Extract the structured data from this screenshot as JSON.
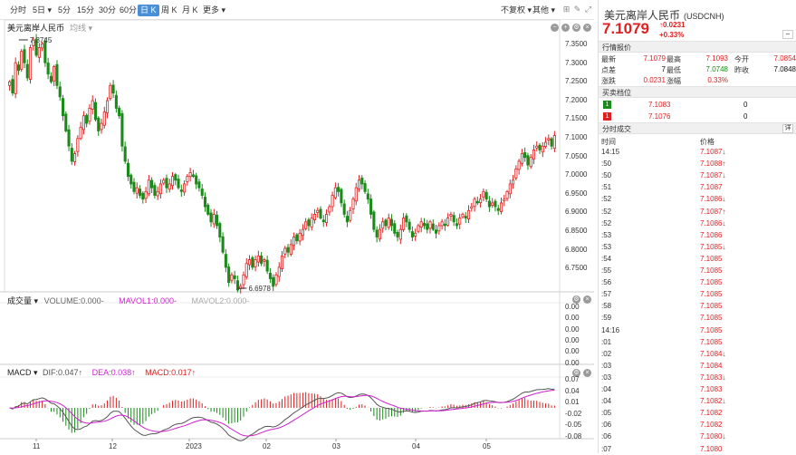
{
  "toolbar": {
    "periods": [
      "分时",
      "5日",
      "5分",
      "15分",
      "30分",
      "60分",
      "日 K",
      "周 K",
      "月 K",
      "更多"
    ],
    "active": "日 K",
    "fq": "不复权",
    "other": "其他"
  },
  "price_panel": {
    "title": "美元离岸人民币",
    "sub": "均线",
    "y_ticks": [
      "7.3500",
      "7.3000",
      "7.2500",
      "7.2000",
      "7.1500",
      "7.1000",
      "7.0500",
      "7.0000",
      "6.9500",
      "6.9000",
      "6.8500",
      "6.8000",
      "6.7500"
    ],
    "high_label": "7.3745",
    "low_label": "6.6978"
  },
  "volume_panel": {
    "title": "成交量",
    "legend": {
      "vol": "VOLUME:0.000-",
      "mavol1": "MAVOL1:0.000-",
      "mavol2": "MAVOL2:0.000-"
    },
    "y_ticks": [
      "0.00",
      "0.00",
      "0.00",
      "0.00",
      "0.00",
      "0.00"
    ]
  },
  "macd_panel": {
    "title": "MACD",
    "legend": {
      "dif": "DIF:0.047↑",
      "dea": "DEA:0.038↑",
      "macd": "MACD:0.017↑"
    },
    "y_ticks": [
      "0.07",
      "0.04",
      "0.01",
      "-0.02",
      "-0.05",
      "-0.08"
    ]
  },
  "x_labels": [
    "11",
    "12",
    "2023",
    "02",
    "03",
    "04",
    "05"
  ],
  "colors": {
    "up": "#e02020",
    "down": "#1a8a1a",
    "dif": "#555555",
    "dea": "#d020d0",
    "accent": "#4a90d9"
  },
  "chart_data": {
    "type": "candlestick",
    "y_range": [
      6.7,
      7.37
    ],
    "annotations": {
      "max": 7.3745,
      "min": 6.6978
    },
    "closes": [
      7.25,
      7.22,
      7.3,
      7.28,
      7.33,
      7.3,
      7.26,
      7.34,
      7.36,
      7.32,
      7.34,
      7.35,
      7.3,
      7.27,
      7.25,
      7.29,
      7.24,
      7.21,
      7.16,
      7.12,
      7.08,
      7.04,
      7.06,
      7.1,
      7.13,
      7.16,
      7.14,
      7.18,
      7.2,
      7.15,
      7.12,
      7.14,
      7.17,
      7.2,
      7.24,
      7.22,
      7.18,
      7.16,
      7.08,
      7.04,
      7.0,
      6.98,
      6.96,
      6.97,
      6.95,
      6.94,
      6.96,
      6.99,
      6.97,
      6.95,
      6.96,
      6.98,
      6.99,
      6.97,
      6.98,
      7.0,
      6.99,
      6.97,
      6.96,
      6.98,
      7.0,
      7.01,
      7.0,
      6.98,
      6.97,
      6.95,
      6.92,
      6.9,
      6.88,
      6.9,
      6.87,
      6.84,
      6.8,
      6.76,
      6.72,
      6.74,
      6.73,
      6.7,
      6.71,
      6.74,
      6.77,
      6.78,
      6.76,
      6.78,
      6.79,
      6.77,
      6.78,
      6.75,
      6.73,
      6.71,
      6.74,
      6.76,
      6.79,
      6.81,
      6.8,
      6.82,
      6.84,
      6.83,
      6.85,
      6.86,
      6.88,
      6.87,
      6.89,
      6.9,
      6.91,
      6.89,
      6.88,
      6.9,
      6.92,
      6.95,
      6.97,
      6.96,
      6.93,
      6.9,
      6.88,
      6.91,
      6.94,
      6.97,
      6.99,
      6.98,
      6.96,
      6.94,
      6.9,
      6.86,
      6.84,
      6.86,
      6.88,
      6.87,
      6.89,
      6.87,
      6.85,
      6.84,
      6.86,
      6.89,
      6.88,
      6.86,
      6.84,
      6.85,
      6.87,
      6.88,
      6.87,
      6.86,
      6.88,
      6.86,
      6.85,
      6.87,
      6.88,
      6.87,
      6.89,
      6.9,
      6.88,
      6.87,
      6.89,
      6.9,
      6.89,
      6.91,
      6.92,
      6.94,
      6.93,
      6.94,
      6.96,
      6.94,
      6.92,
      6.93,
      6.92,
      6.91,
      6.93,
      6.94,
      6.96,
      6.98,
      6.99,
      7.02,
      7.04,
      7.06,
      7.05,
      7.03,
      7.05,
      7.07,
      7.08,
      7.07,
      7.08,
      7.09,
      7.1,
      7.08,
      7.1079
    ]
  },
  "quote": {
    "name": "美元离岸人民币",
    "code": "(USDCNH)",
    "price": "7.1079",
    "chg": "0.0231",
    "chg_pct": "+0.33%",
    "section_title": "行情报价",
    "fields": [
      {
        "label": "最新",
        "value": "7.1079",
        "color": "red"
      },
      {
        "label": "最高",
        "value": "7.1093",
        "color": "red"
      },
      {
        "label": "今开",
        "value": "7.0854",
        "color": "red"
      },
      {
        "label": "点差",
        "value": "7",
        "color": "dark"
      },
      {
        "label": "最低",
        "value": "7.0748",
        "color": "green"
      },
      {
        "label": "昨收",
        "value": "7.0848",
        "color": "dark"
      },
      {
        "label": "涨跌",
        "value": "0.0231",
        "color": "red"
      },
      {
        "label": "涨幅",
        "value": "0.33%",
        "color": "red"
      }
    ]
  },
  "orderbook": {
    "title": "买卖档位",
    "rows": [
      {
        "badge": "1",
        "price": "7.1083",
        "vol": "0"
      },
      {
        "badge": "1",
        "price": "7.1076",
        "vol": "0"
      }
    ]
  },
  "ticks": {
    "title": "分时成交",
    "detail_btn": "详",
    "col_time": "时间",
    "col_price": "价格",
    "rows": [
      {
        "t": "14:15",
        "p": "7.1087",
        "d": "↓"
      },
      {
        "t": ":50",
        "p": "7.1088",
        "d": "↑"
      },
      {
        "t": ":50",
        "p": "7.1087",
        "d": "↓"
      },
      {
        "t": ":51",
        "p": "7.1087",
        "d": ""
      },
      {
        "t": ":52",
        "p": "7.1086",
        "d": "↓"
      },
      {
        "t": ":52",
        "p": "7.1087",
        "d": "↑"
      },
      {
        "t": ":52",
        "p": "7.1086",
        "d": "↓"
      },
      {
        "t": ":53",
        "p": "7.1086",
        "d": ""
      },
      {
        "t": ":53",
        "p": "7.1085",
        "d": "↓"
      },
      {
        "t": ":54",
        "p": "7.1085",
        "d": ""
      },
      {
        "t": ":55",
        "p": "7.1085",
        "d": ""
      },
      {
        "t": ":56",
        "p": "7.1085",
        "d": ""
      },
      {
        "t": ":57",
        "p": "7.1085",
        "d": ""
      },
      {
        "t": ":58",
        "p": "7.1085",
        "d": ""
      },
      {
        "t": ":59",
        "p": "7.1085",
        "d": ""
      },
      {
        "t": "14:16",
        "p": "7.1085",
        "d": ""
      },
      {
        "t": ":01",
        "p": "7.1085",
        "d": ""
      },
      {
        "t": ":02",
        "p": "7.1084",
        "d": "↓"
      },
      {
        "t": ":03",
        "p": "7.1084",
        "d": ""
      },
      {
        "t": ":03",
        "p": "7.1083",
        "d": "↓"
      },
      {
        "t": ":04",
        "p": "7.1083",
        "d": ""
      },
      {
        "t": ":04",
        "p": "7.1082",
        "d": "↓"
      },
      {
        "t": ":05",
        "p": "7.1082",
        "d": ""
      },
      {
        "t": ":06",
        "p": "7.1082",
        "d": ""
      },
      {
        "t": ":06",
        "p": "7.1080",
        "d": "↓"
      },
      {
        "t": ":07",
        "p": "7.1080",
        "d": ""
      }
    ]
  }
}
